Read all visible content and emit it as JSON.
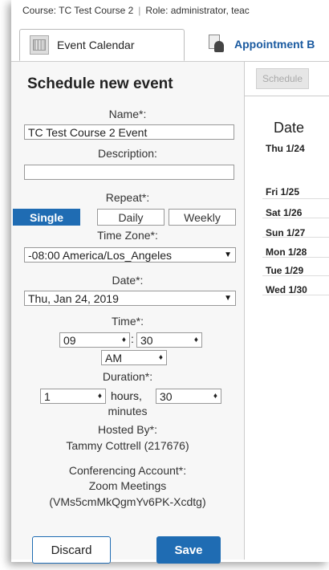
{
  "header": {
    "course": "Course: TC Test Course 2",
    "separator": "|",
    "role": "Role: administrator, teac"
  },
  "tabs": [
    {
      "label": "Event Calendar",
      "icon": "calendar-icon",
      "active": true
    },
    {
      "label": "Appointment B",
      "icon": "appointment-icon",
      "active": false
    }
  ],
  "form": {
    "title": "Schedule new event",
    "name_label": "Name*:",
    "name_value": "TC Test Course 2 Event",
    "description_label": "Description:",
    "description_value": "",
    "repeat_label": "Repeat*:",
    "repeat_options": [
      "Single",
      "Daily",
      "Weekly"
    ],
    "repeat_selected": "Single",
    "timezone_label": "Time Zone*:",
    "timezone_value": "-08:00 America/Los_Angeles",
    "date_label": "Date*:",
    "date_value": "Thu, Jan 24, 2019",
    "time_label": "Time*:",
    "time_hour": "09",
    "time_colon": ":",
    "time_minute": "30",
    "time_ampm": "AM",
    "duration_label": "Duration*:",
    "duration_hours": "1",
    "duration_hours_unit": "hours,",
    "duration_minutes": "30",
    "duration_minutes_unit": "minutes",
    "hosted_label": "Hosted By*:",
    "hosted_value": "Tammy Cottrell (217676)",
    "conf_label": "Conferencing Account*:",
    "conf_name": "Zoom Meetings",
    "conf_id": "(VMs5cmMkQgmYv6PK-Xcdtg)",
    "discard_label": "Discard",
    "save_label": "Save"
  },
  "schedule_panel": {
    "button_label": "Schedule",
    "date_header": "Date",
    "rows": [
      "Thu 1/24",
      "Fri 1/25",
      "Sat 1/26",
      "Sun 1/27",
      "Mon 1/28",
      "Tue 1/29",
      "Wed 1/30"
    ]
  },
  "colors": {
    "accent": "#1f6cb3",
    "tab_link": "#1a5aa0",
    "panel_bg": "#f7f7f7"
  }
}
